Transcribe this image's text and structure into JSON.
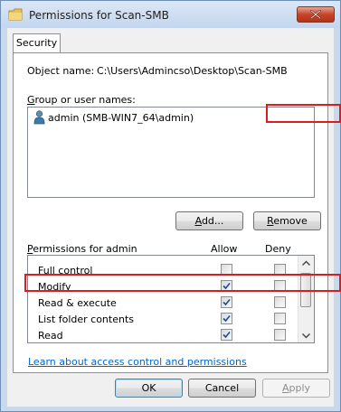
{
  "window": {
    "title": "Permissions for Scan-SMB",
    "close_icon": "close-icon",
    "folder_icon": "folder-icon"
  },
  "tabs": [
    {
      "label": "Security"
    }
  ],
  "object": {
    "label": "Object name:",
    "value": "C:\\Users\\Admincso\\Desktop\\Scan-SMB"
  },
  "group": {
    "label_prefix": "G",
    "label_rest": "roup or user names:",
    "users": [
      {
        "name": "admin (SMB-WIN7_64\\admin)",
        "icon": "user-icon"
      }
    ]
  },
  "buttons": {
    "add_u": "A",
    "add_rest": "dd...",
    "remove_u": "R",
    "remove_rest": "emove",
    "ok": "OK",
    "cancel": "Cancel",
    "apply_u": "A",
    "apply_rest": "pply"
  },
  "permissions": {
    "label_prefix": "P",
    "label_rest": "ermissions for admin",
    "allow_header": "Allow",
    "deny_header": "Deny",
    "rows": [
      {
        "name": "Full control",
        "allow": false,
        "deny": false
      },
      {
        "name": "Modify",
        "allow": true,
        "deny": false
      },
      {
        "name": "Read & execute",
        "allow": true,
        "deny": false
      },
      {
        "name": "List folder contents",
        "allow": true,
        "deny": false
      },
      {
        "name": "Read",
        "allow": true,
        "deny": false
      }
    ]
  },
  "link_text": "Learn about access control and permissions",
  "colors": {
    "highlight": "#d81e1e",
    "link": "#0066cc"
  }
}
